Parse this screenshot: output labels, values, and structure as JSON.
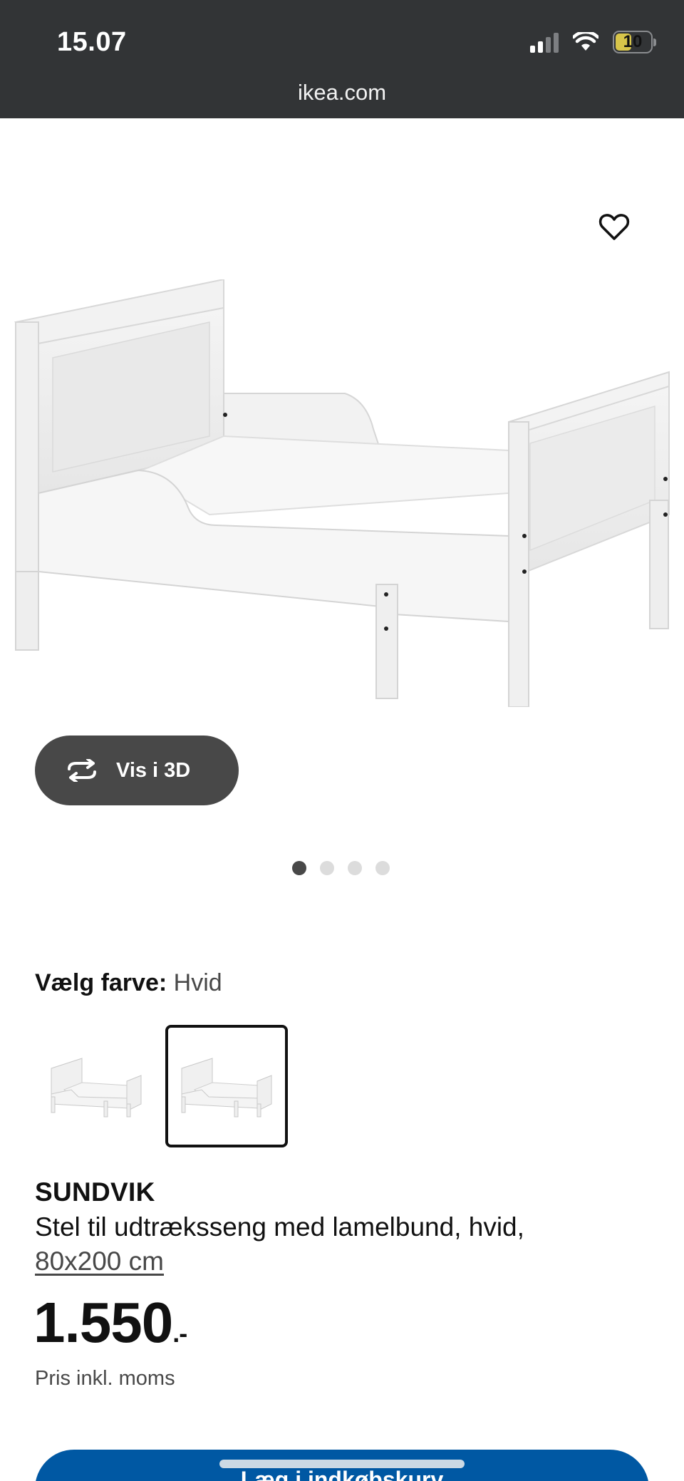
{
  "status_bar": {
    "time": "15.07",
    "battery": "10",
    "icons": [
      "signal-icon",
      "wifi-icon",
      "battery-icon"
    ]
  },
  "browser": {
    "url": "ikea.com"
  },
  "gallery": {
    "favorite_icon": "heart-icon",
    "view_3d_label": "Vis i 3D",
    "view_3d_icon": "rotate-icon",
    "image_count": 4,
    "active_index": 0
  },
  "color_selector": {
    "label": "Vælg farve:",
    "value": "Hvid",
    "options": [
      {
        "name": "white-bed-variant-1",
        "selected": false
      },
      {
        "name": "white-bed-variant-2",
        "selected": true
      }
    ]
  },
  "product": {
    "name": "SUNDVIK",
    "description": "Stel til udtræksseng med lamelbund, hvid,",
    "size": "80x200 cm",
    "price": "1.550",
    "price_suffix": ".-",
    "vat_note": "Pris inkl. moms"
  },
  "cta": {
    "label": "Læg i indkøbskurv"
  },
  "colors": {
    "topbar": "#323436",
    "button_dark": "#484848",
    "cta_blue": "#0058a3"
  }
}
